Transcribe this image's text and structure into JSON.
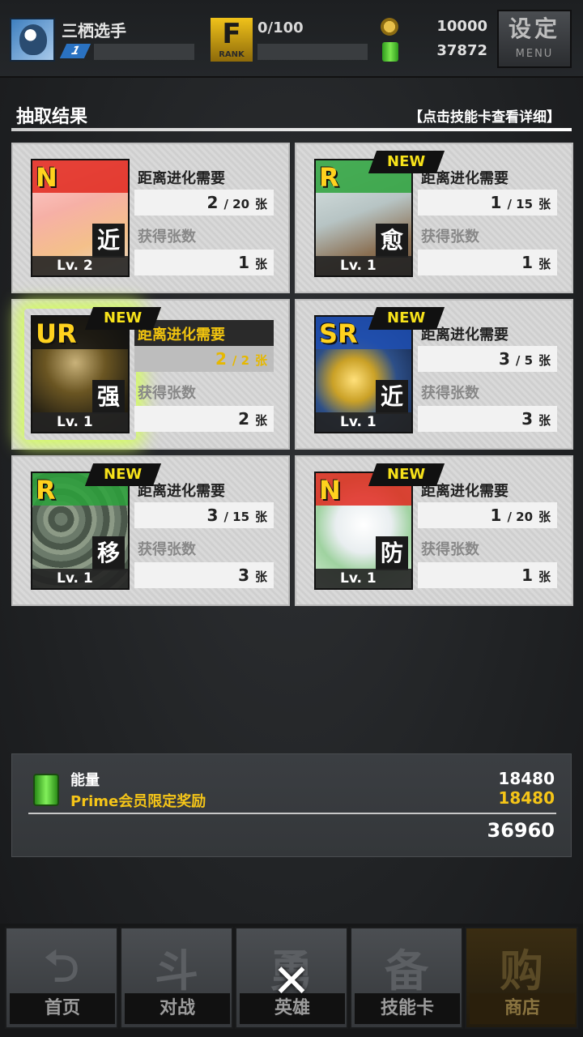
{
  "header": {
    "player_name": "三栖选手",
    "player_level": "1",
    "rank_letter": "F",
    "rank_caption": "RANK",
    "rank_progress": "0/100",
    "coins": "10000",
    "energy": "37872",
    "settings_label": "设定",
    "settings_sub": "MENU"
  },
  "results": {
    "title": "抽取结果",
    "hint": "【点击技能卡查看详细】"
  },
  "labels": {
    "evolve": "距离进化需要",
    "obtained": "获得张数",
    "unit": "张",
    "new": "NEW"
  },
  "cards": [
    {
      "rarity": "N",
      "type": "近",
      "level": "Lv. 2",
      "evo_cur": "2",
      "evo_req": "20",
      "count": "1",
      "new": false
    },
    {
      "rarity": "R",
      "type": "愈",
      "level": "Lv. 1",
      "evo_cur": "1",
      "evo_req": "15",
      "count": "1",
      "new": true
    },
    {
      "rarity": "UR",
      "type": "强",
      "level": "Lv. 1",
      "evo_cur": "2",
      "evo_req": "2",
      "count": "2",
      "new": true
    },
    {
      "rarity": "SR",
      "type": "近",
      "level": "Lv. 1",
      "evo_cur": "3",
      "evo_req": "5",
      "count": "3",
      "new": true
    },
    {
      "rarity": "R",
      "type": "移",
      "level": "Lv. 1",
      "evo_cur": "3",
      "evo_req": "15",
      "count": "3",
      "new": true
    },
    {
      "rarity": "N",
      "type": "防",
      "level": "Lv. 1",
      "evo_cur": "1",
      "evo_req": "20",
      "count": "1",
      "new": true
    }
  ],
  "summary": {
    "label": "能量",
    "bonus_label": "Prime会员限定奖励",
    "value": "18480",
    "bonus_value": "18480",
    "total": "36960"
  },
  "nav": {
    "home_glyph": "⮌",
    "home": "首页",
    "battle_glyph": "斗",
    "battle": "对战",
    "hero_glyph": "勇",
    "hero": "英雄",
    "skill_glyph": "备",
    "skill": "技能卡",
    "shop_glyph": "购",
    "shop": "商店",
    "close": "✕"
  }
}
